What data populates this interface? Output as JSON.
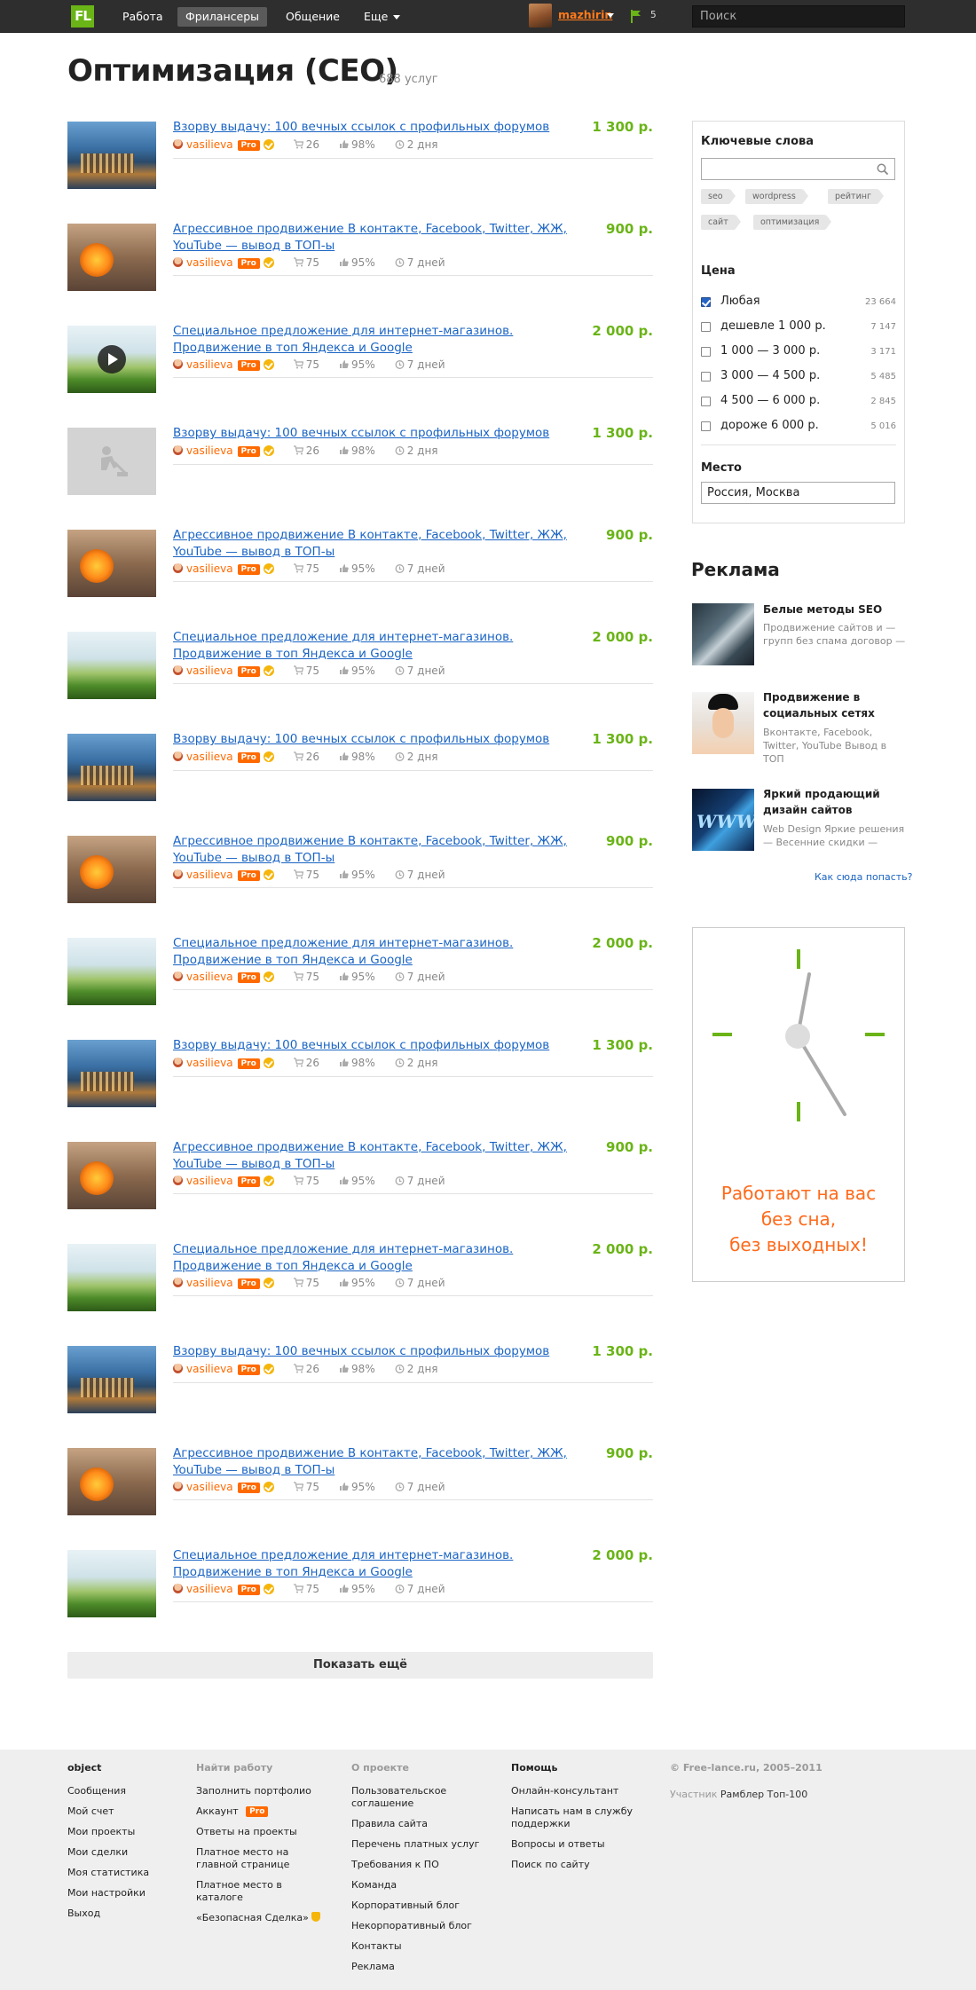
{
  "topbar": {
    "logo": "FL",
    "nav": [
      {
        "label": "Работа"
      },
      {
        "label": "Фрилансеры"
      },
      {
        "label": "Общение"
      },
      {
        "label": "Еще"
      }
    ],
    "username": "mazhirin",
    "notifications": "5",
    "search_placeholder": "Поиск"
  },
  "header": {
    "title": "Оптимизация (CEO)",
    "count": "688 услуг"
  },
  "listing": {
    "items": [
      {
        "title": "Взорву выдачу: 100 вечных ссылок с профильных  форумов",
        "price": "1 300 р.",
        "user": "vasilieva",
        "sales": "26",
        "rating": "98%",
        "days": "2 дня",
        "thumb": "city"
      },
      {
        "title": "Агрессивное продвижение В контакте, Facebook, Twitter, ЖЖ, YouTube — вывод в ТОП-ы",
        "price": "900 р.",
        "user": "vasilieva",
        "sales": "75",
        "rating": "95%",
        "days": "7 дней",
        "thumb": "flower"
      },
      {
        "title": "Специальное предложение для интернет-магазинов. Продвижение в топ Яндекса и Google",
        "price": "2 000 р.",
        "user": "vasilieva",
        "sales": "75",
        "rating": "95%",
        "days": "7 дней",
        "thumb": "grass-play"
      },
      {
        "title": "Взорву выдачу: 100 вечных ссылок с профильных  форумов",
        "price": "1 300 р.",
        "user": "vasilieva",
        "sales": "26",
        "rating": "98%",
        "days": "2 дня",
        "thumb": "gray"
      },
      {
        "title": "Агрессивное продвижение В контакте, Facebook, Twitter, ЖЖ, YouTube — вывод в ТОП-ы",
        "price": "900 р.",
        "user": "vasilieva",
        "sales": "75",
        "rating": "95%",
        "days": "7 дней",
        "thumb": "flower"
      },
      {
        "title": "Специальное предложение для интернет-магазинов. Продвижение в топ Яндекса и Google",
        "price": "2 000 р.",
        "user": "vasilieva",
        "sales": "75",
        "rating": "95%",
        "days": "7 дней",
        "thumb": "grass"
      },
      {
        "title": "Взорву выдачу: 100 вечных ссылок с профильных  форумов",
        "price": "1 300 р.",
        "user": "vasilieva",
        "sales": "26",
        "rating": "98%",
        "days": "2 дня",
        "thumb": "city"
      },
      {
        "title": "Агрессивное продвижение В контакте, Facebook, Twitter, ЖЖ, YouTube — вывод в ТОП-ы",
        "price": "900 р.",
        "user": "vasilieva",
        "sales": "75",
        "rating": "95%",
        "days": "7 дней",
        "thumb": "flower"
      },
      {
        "title": "Специальное предложение для интернет-магазинов. Продвижение в топ Яндекса и Google",
        "price": "2 000 р.",
        "user": "vasilieva",
        "sales": "75",
        "rating": "95%",
        "days": "7 дней",
        "thumb": "grass"
      },
      {
        "title": "Взорву выдачу: 100 вечных ссылок с профильных  форумов",
        "price": "1 300 р.",
        "user": "vasilieva",
        "sales": "26",
        "rating": "98%",
        "days": "2 дня",
        "thumb": "city"
      },
      {
        "title": "Агрессивное продвижение В контакте, Facebook, Twitter, ЖЖ, YouTube — вывод в ТОП-ы",
        "price": "900 р.",
        "user": "vasilieva",
        "sales": "75",
        "rating": "95%",
        "days": "7 дней",
        "thumb": "flower"
      },
      {
        "title": "Специальное предложение для интернет-магазинов. Продвижение в топ Яндекса и Google",
        "price": "2 000 р.",
        "user": "vasilieva",
        "sales": "75",
        "rating": "95%",
        "days": "7 дней",
        "thumb": "grass"
      },
      {
        "title": "Взорву выдачу: 100 вечных ссылок с профильных  форумов",
        "price": "1 300 р.",
        "user": "vasilieva",
        "sales": "26",
        "rating": "98%",
        "days": "2 дня",
        "thumb": "city"
      },
      {
        "title": "Агрессивное продвижение В контакте, Facebook, Twitter, ЖЖ, YouTube — вывод в ТОП-ы",
        "price": "900 р.",
        "user": "vasilieva",
        "sales": "75",
        "rating": "95%",
        "days": "7 дней",
        "thumb": "flower"
      },
      {
        "title": "Специальное предложение для интернет-магазинов. Продвижение в топ Яндекса и Google",
        "price": "2 000 р.",
        "user": "vasilieva",
        "sales": "75",
        "rating": "95%",
        "days": "7 дней",
        "thumb": "grass"
      }
    ],
    "pro_label": "Pro",
    "show_more": "Показать ещё"
  },
  "filters": {
    "keywords_label": "Ключевые слова",
    "tags": [
      "seo",
      "wordpress",
      "рейтинг",
      "сайт",
      "оптимизация"
    ],
    "price_label": "Цена",
    "price_options": [
      {
        "label": "Любая",
        "count": "23 664",
        "checked": true
      },
      {
        "label": "дешевле 1 000 р.",
        "count": "7 147",
        "checked": false
      },
      {
        "label": "1 000 — 3 000 р.",
        "count": "3 171",
        "checked": false
      },
      {
        "label": "3 000 — 4 500 р.",
        "count": "5 485",
        "checked": false
      },
      {
        "label": "4 500 — 6 000 р.",
        "count": "2 845",
        "checked": false
      },
      {
        "label": "дороже 6 000 р.",
        "count": "5 016",
        "checked": false
      }
    ],
    "place_label": "Место",
    "place_value": "Россия, Москва"
  },
  "ads": {
    "title": "Реклама",
    "items": [
      {
        "title": "Белые методы SEO",
        "text": "Продвижение сайтов и — групп без спама договор —"
      },
      {
        "title": "Продвижение в социальных сетях",
        "text": "Вконтакте, Facebook, Twitter, YouTube Вывод в ТОП"
      },
      {
        "title": "Яркий продающий дизайн сайтов",
        "text": "Web Design Яркие решения — Весенние скидки —"
      }
    ],
    "ad_image_text": "WWW",
    "how_link": "Как сюда попасть?"
  },
  "banner": {
    "line1": "Работают на вас",
    "line2": "без сна,",
    "line3": "без выходных!"
  },
  "footer": {
    "col1": {
      "heading": "object",
      "links": [
        "Сообщения",
        "Мой счет",
        "Мои проекты",
        "Мои сделки",
        "Моя статистика",
        "Мои настройки",
        "Выход"
      ]
    },
    "col2": {
      "heading": "Найти работу",
      "links": [
        "Заполнить портфолио",
        "Аккаунт",
        "Ответы на проекты",
        "Платное место на главной странице",
        "Платное место в каталоге",
        "«Безопасная Сделка»"
      ]
    },
    "col3": {
      "heading": "О проекте",
      "links": [
        "Пользовательское соглашение",
        "Правила сайта",
        "Перечень платных услуг",
        "Требования к ПО",
        "Команда",
        "Корпоративный блог",
        "Некорпоративный блог",
        "Контакты",
        "Реклама"
      ]
    },
    "col4": {
      "heading": "Помощь",
      "links": [
        "Онлайн-консультант",
        "Написать нам в службу поддержки",
        "Вопросы и ответы",
        "Поиск по сайту"
      ]
    },
    "copyright": "© Free-lance.ru, 2005–2011",
    "member_label": "Участник",
    "member_value": "Рамблер Топ-100"
  },
  "colors": {
    "accent_green": "#6ab417",
    "link_blue": "#1a64c4",
    "pro_orange": "#ff6a00",
    "topbar_bg": "#2e2e2e"
  }
}
